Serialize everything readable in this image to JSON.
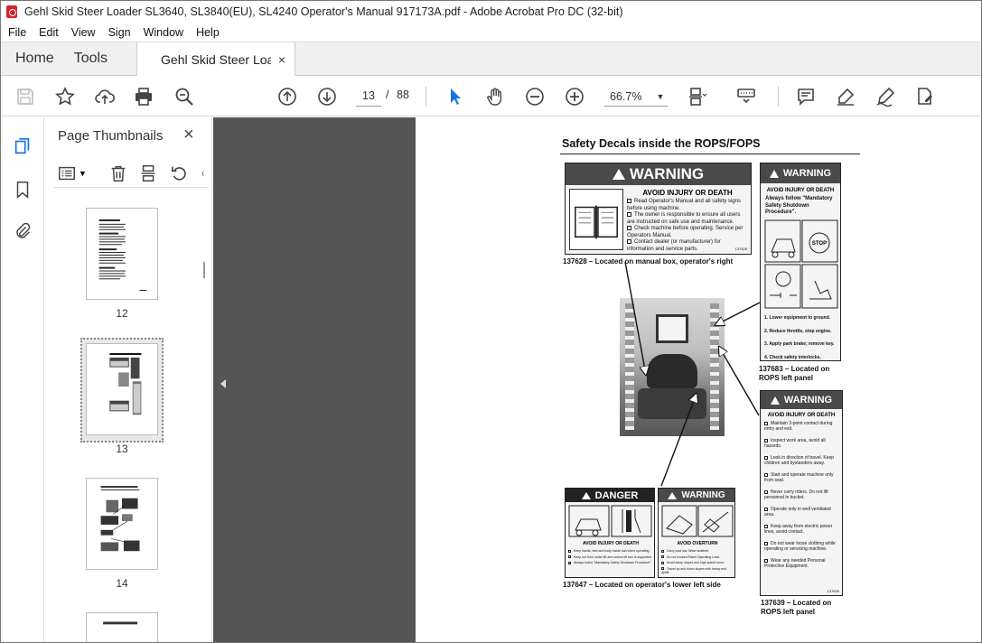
{
  "window": {
    "title": "Gehl Skid Steer Loader SL3640, SL3840(EU), SL4240 Operator's Manual 917173A.pdf - Adobe Acrobat Pro DC (32-bit)"
  },
  "menu": [
    "File",
    "Edit",
    "View",
    "Sign",
    "Window",
    "Help"
  ],
  "tabs": {
    "home": "Home",
    "tools": "Tools",
    "document": "Gehl Skid Steer Loa...",
    "close": "×"
  },
  "toolbar": {
    "current_page": "13",
    "page_sep": "/",
    "total_pages": "88",
    "zoom": "66.7%"
  },
  "thumbnails": {
    "title": "Page Thumbnails",
    "close": "×",
    "pages": [
      {
        "label": "12"
      },
      {
        "label": "13"
      },
      {
        "label": "14"
      }
    ],
    "selected": "13"
  },
  "document": {
    "heading": "Safety Decals inside the ROPS/FOPS",
    "decal_warning_main": {
      "header": "WARNING",
      "subheader": "AVOID INJURY OR DEATH",
      "items": [
        "Read Operator's Manual and all safety signs before using machine.",
        "The owner is responsible to ensure all users are instructed on safe use and maintenance.",
        "Check machine before operating. Service per Operators Manual.",
        "Contact dealer (or manufacturer) for information and service parts."
      ],
      "code": "137628",
      "caption": "137628 – Located on manual box, operator's right"
    },
    "decal_warning_shutdown": {
      "header": "WARNING",
      "subheader": "AVOID INJURY OR DEATH",
      "intro": "Always follow \"Mandatory Safety Shutdown Procedure\".",
      "stop": "STOP",
      "steps": [
        "1. Lower equipment to ground.",
        "2. Reduce throttle, stop engine.",
        "3. Apply park brake; remove key.",
        "4. Check safety interlocks."
      ],
      "caption_line1": "137683 – Located on",
      "caption_line2": "ROPS left panel"
    },
    "decal_warning_list": {
      "header": "WARNING",
      "subheader": "AVOID INJURY OR DEATH",
      "items": [
        "Maintain 3-point contact during entry and exit.",
        "Inspect work area, avoid all hazards.",
        "Look in direction of travel. Keep children and bystanders away.",
        "Start and operate machine only from seat.",
        "Never carry riders. Do not lift personnel in bucket.",
        "Operate only in well ventilated area.",
        "Keep away from electric power lines, avoid contact.",
        "Do not wear loose clothing while operating or servicing machine.",
        "Wear any needed Personal Protective Equipment."
      ],
      "code": "137639",
      "caption_line1": "137639 – Located on",
      "caption_line2": "ROPS left panel"
    },
    "decal_danger": {
      "header": "DANGER",
      "subheader": "AVOID INJURY OR DEATH",
      "items": [
        "Keep hands, feet and body inside cab when operating.",
        "Keep out from under lift arm unless lift arm is supported.",
        "Always follow \"Mandatory Safety Shutdown Procedure\"."
      ]
    },
    "decal_overturn": {
      "header": "WARNING",
      "subheader": "AVOID OVERTURN",
      "items": [
        "Carry load low. Wear seatbelt.",
        "Do not exceed Rated Operating Load.",
        "Avoid steep slopes and high speed turns.",
        "Travel up and down slopes with heavy end uphill."
      ]
    },
    "caption_bottom": "137647 – Located on operator's lower left side"
  }
}
